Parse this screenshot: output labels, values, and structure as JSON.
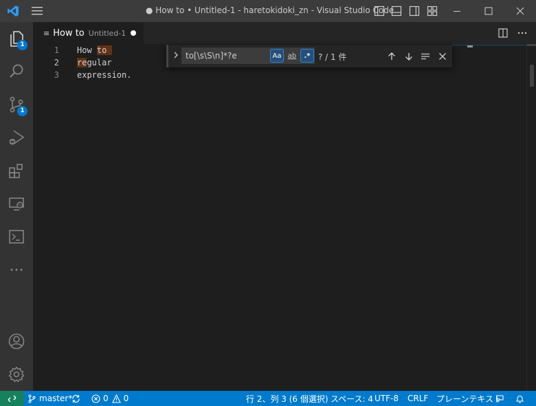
{
  "window": {
    "title": "● How to • Untitled-1 - haretokidoki_zn - Visual Studio Code"
  },
  "activity_bar": {
    "items": [
      {
        "name": "explorer",
        "icon": "files-icon",
        "badge": "1"
      },
      {
        "name": "search",
        "icon": "search-icon"
      },
      {
        "name": "source-control",
        "icon": "source-control-icon",
        "badge": "1"
      },
      {
        "name": "run-debug",
        "icon": "debug-icon"
      },
      {
        "name": "extensions",
        "icon": "extensions-icon"
      },
      {
        "name": "remote-explorer",
        "icon": "remote-explorer-icon"
      },
      {
        "name": "terminal",
        "icon": "terminal-icon"
      },
      {
        "name": "more",
        "icon": "ellipsis-icon"
      }
    ],
    "accounts_icon": "account-icon",
    "settings_icon": "gear-icon"
  },
  "tab": {
    "label": "How to",
    "description": "Untitled-1",
    "dirty": true
  },
  "editor": {
    "lines": [
      {
        "number": "1",
        "segments": [
          {
            "text": "How ",
            "match": false
          },
          {
            "text": "to ",
            "match": true
          }
        ]
      },
      {
        "number": "2",
        "segments": [
          {
            "text": "re",
            "match": true
          },
          {
            "text": "gular",
            "match": false
          }
        ]
      },
      {
        "number": "3",
        "segments": [
          {
            "text": "expression.",
            "match": false
          }
        ]
      }
    ]
  },
  "find": {
    "query": "to[\\s\\S\\n]*?e",
    "match_case_label": "Aa",
    "whole_word_label": "ab",
    "regex_label": ".*",
    "count": "? / 1 件"
  },
  "status": {
    "branch": "master*",
    "errors": "0",
    "warnings": "0",
    "position": "行 2、列 3 (6 個選択)",
    "spaces": "スペース: 4",
    "encoding": "UTF-8",
    "eol": "CRLF",
    "language": "プレーンテキスト"
  },
  "colors": {
    "accent": "#007acc",
    "remote": "#16825d",
    "match": "#ea5c00"
  }
}
